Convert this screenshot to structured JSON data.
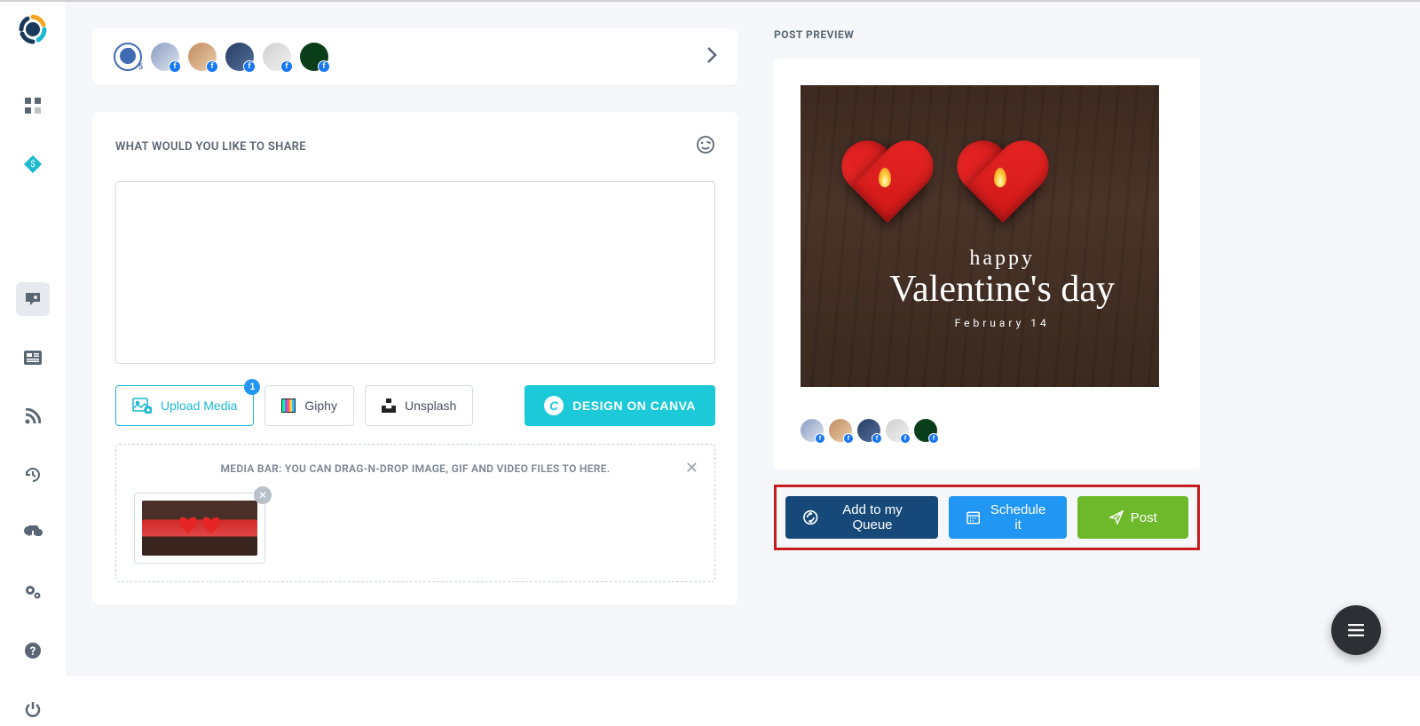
{
  "sidebar": {
    "items": [
      "dashboard",
      "billing",
      "compose",
      "articles",
      "feed",
      "history",
      "download",
      "settings",
      "help",
      "power"
    ]
  },
  "profiles": {
    "counter_label": "5",
    "count": 5
  },
  "composer": {
    "title": "WHAT WOULD YOU LIKE TO SHARE",
    "textarea_value": "",
    "upload_label": "Upload Media",
    "upload_badge": "1",
    "giphy_label": "Giphy",
    "unsplash_label": "Unsplash",
    "canva_label": "DESIGN ON CANVA",
    "media_bar_text": "MEDIA BAR: YOU CAN DRAG-N-DROP IMAGE, GIF AND VIDEO FILES TO HERE."
  },
  "preview": {
    "title": "POST PREVIEW",
    "image_text_line1": "happy",
    "image_text_line2": "Valentine's day",
    "image_text_line3": "February 14"
  },
  "actions": {
    "queue_label": "Add to my Queue",
    "schedule_label": "Schedule it",
    "post_label": "Post"
  }
}
